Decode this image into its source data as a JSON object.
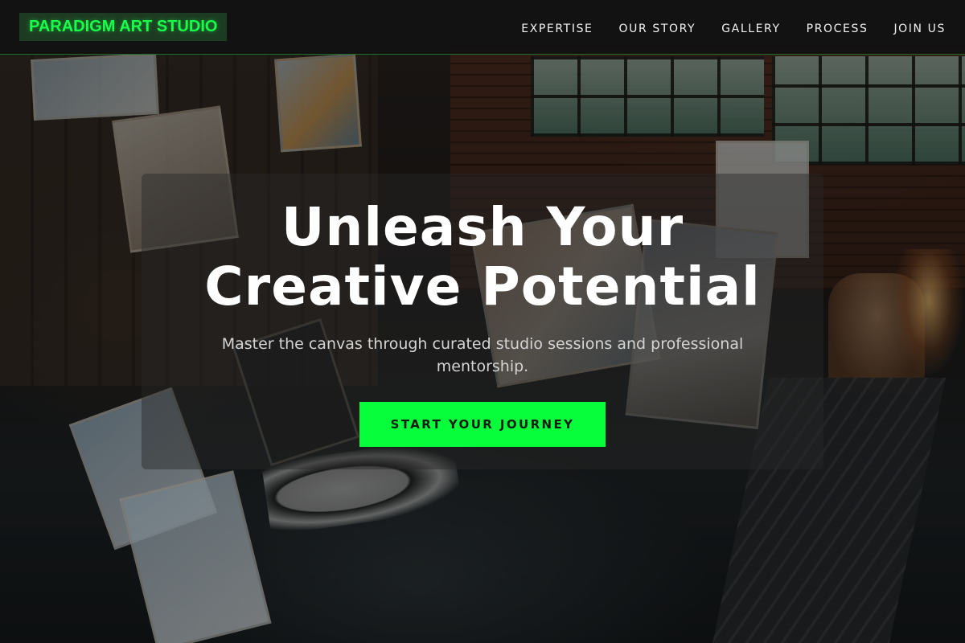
{
  "brand": {
    "name": "PARADIGM ART STUDIO"
  },
  "nav": {
    "items": [
      {
        "label": "EXPERTISE"
      },
      {
        "label": "OUR STORY"
      },
      {
        "label": "GALLERY"
      },
      {
        "label": "PROCESS"
      },
      {
        "label": "JOIN US"
      }
    ]
  },
  "hero": {
    "title_line1": "Unleash Your",
    "title_line2": "Creative Potential",
    "subtitle": "Master the canvas through curated studio sessions and professional mentorship.",
    "cta_label": "START YOUR JOURNEY",
    "background_image": "art-studio-interior-photo"
  },
  "colors": {
    "accent": "#06ff3a",
    "brand_text": "#19ff4a",
    "brand_bg": "#1d3b22",
    "navbar_bg": "#121212",
    "text_primary": "#ffffff",
    "text_secondary": "#d4d4d4"
  }
}
